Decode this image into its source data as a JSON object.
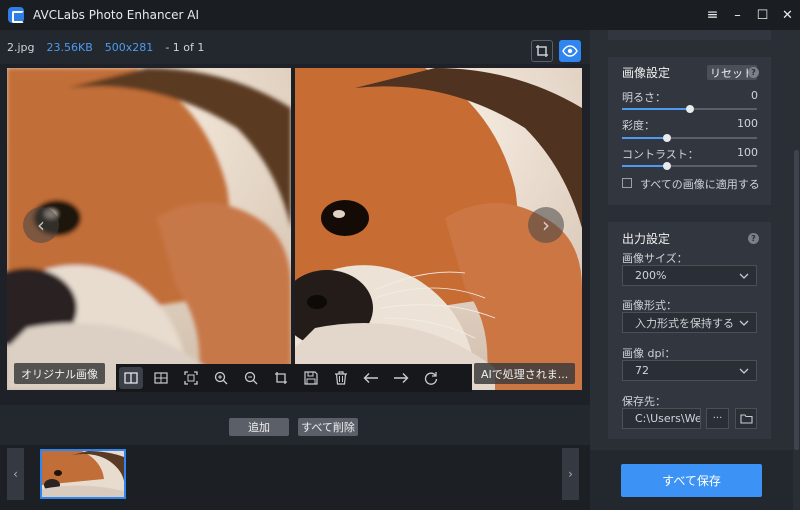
{
  "app": {
    "title": "AVCLabs Photo Enhancer AI"
  },
  "window_controls": [
    "≡",
    "–",
    "☐",
    "✕"
  ],
  "file_info": {
    "name": "2.jpg",
    "size": "23.56KB",
    "dimensions": "500x281",
    "page": "- 1 of 1"
  },
  "preview": {
    "original_label": "オリジナル画像",
    "ai_label": "AIで処理されま..."
  },
  "toolbar_icons": [
    "split-view-icon",
    "grid-view-icon",
    "fit-screen-icon",
    "zoom-in-icon",
    "zoom-out-icon",
    "crop-icon",
    "save-icon",
    "delete-icon",
    "arrow-left-icon",
    "arrow-right-icon",
    "rotate-icon"
  ],
  "actions": {
    "add": "追加",
    "delete_all": "すべて削除"
  },
  "image_settings": {
    "title": "画像設定",
    "reset": "リセット",
    "brightness": {
      "label": "明るさ：",
      "value": "0",
      "level": 0.5
    },
    "saturation": {
      "label": "彩度：",
      "value": "100",
      "level": 0.33
    },
    "contrast": {
      "label": "コントラスト：",
      "value": "100",
      "level": 0.33
    },
    "apply_all": "すべての画像に適用する"
  },
  "output_settings": {
    "title": "出力設定",
    "size_label": "画像サイズ：",
    "size_value": "200%",
    "format_label": "画像形式：",
    "format_value": "入力形式を保持する",
    "dpi_label": "画像 dpi：",
    "dpi_value": "72",
    "dest_label": "保存先：",
    "dest_value": "C:\\Users\\We",
    "browse": "···"
  },
  "save_all": "すべて保存",
  "colors": {
    "accent": "#3d93f5",
    "panel": "#2a2e35",
    "card": "#32363e"
  }
}
